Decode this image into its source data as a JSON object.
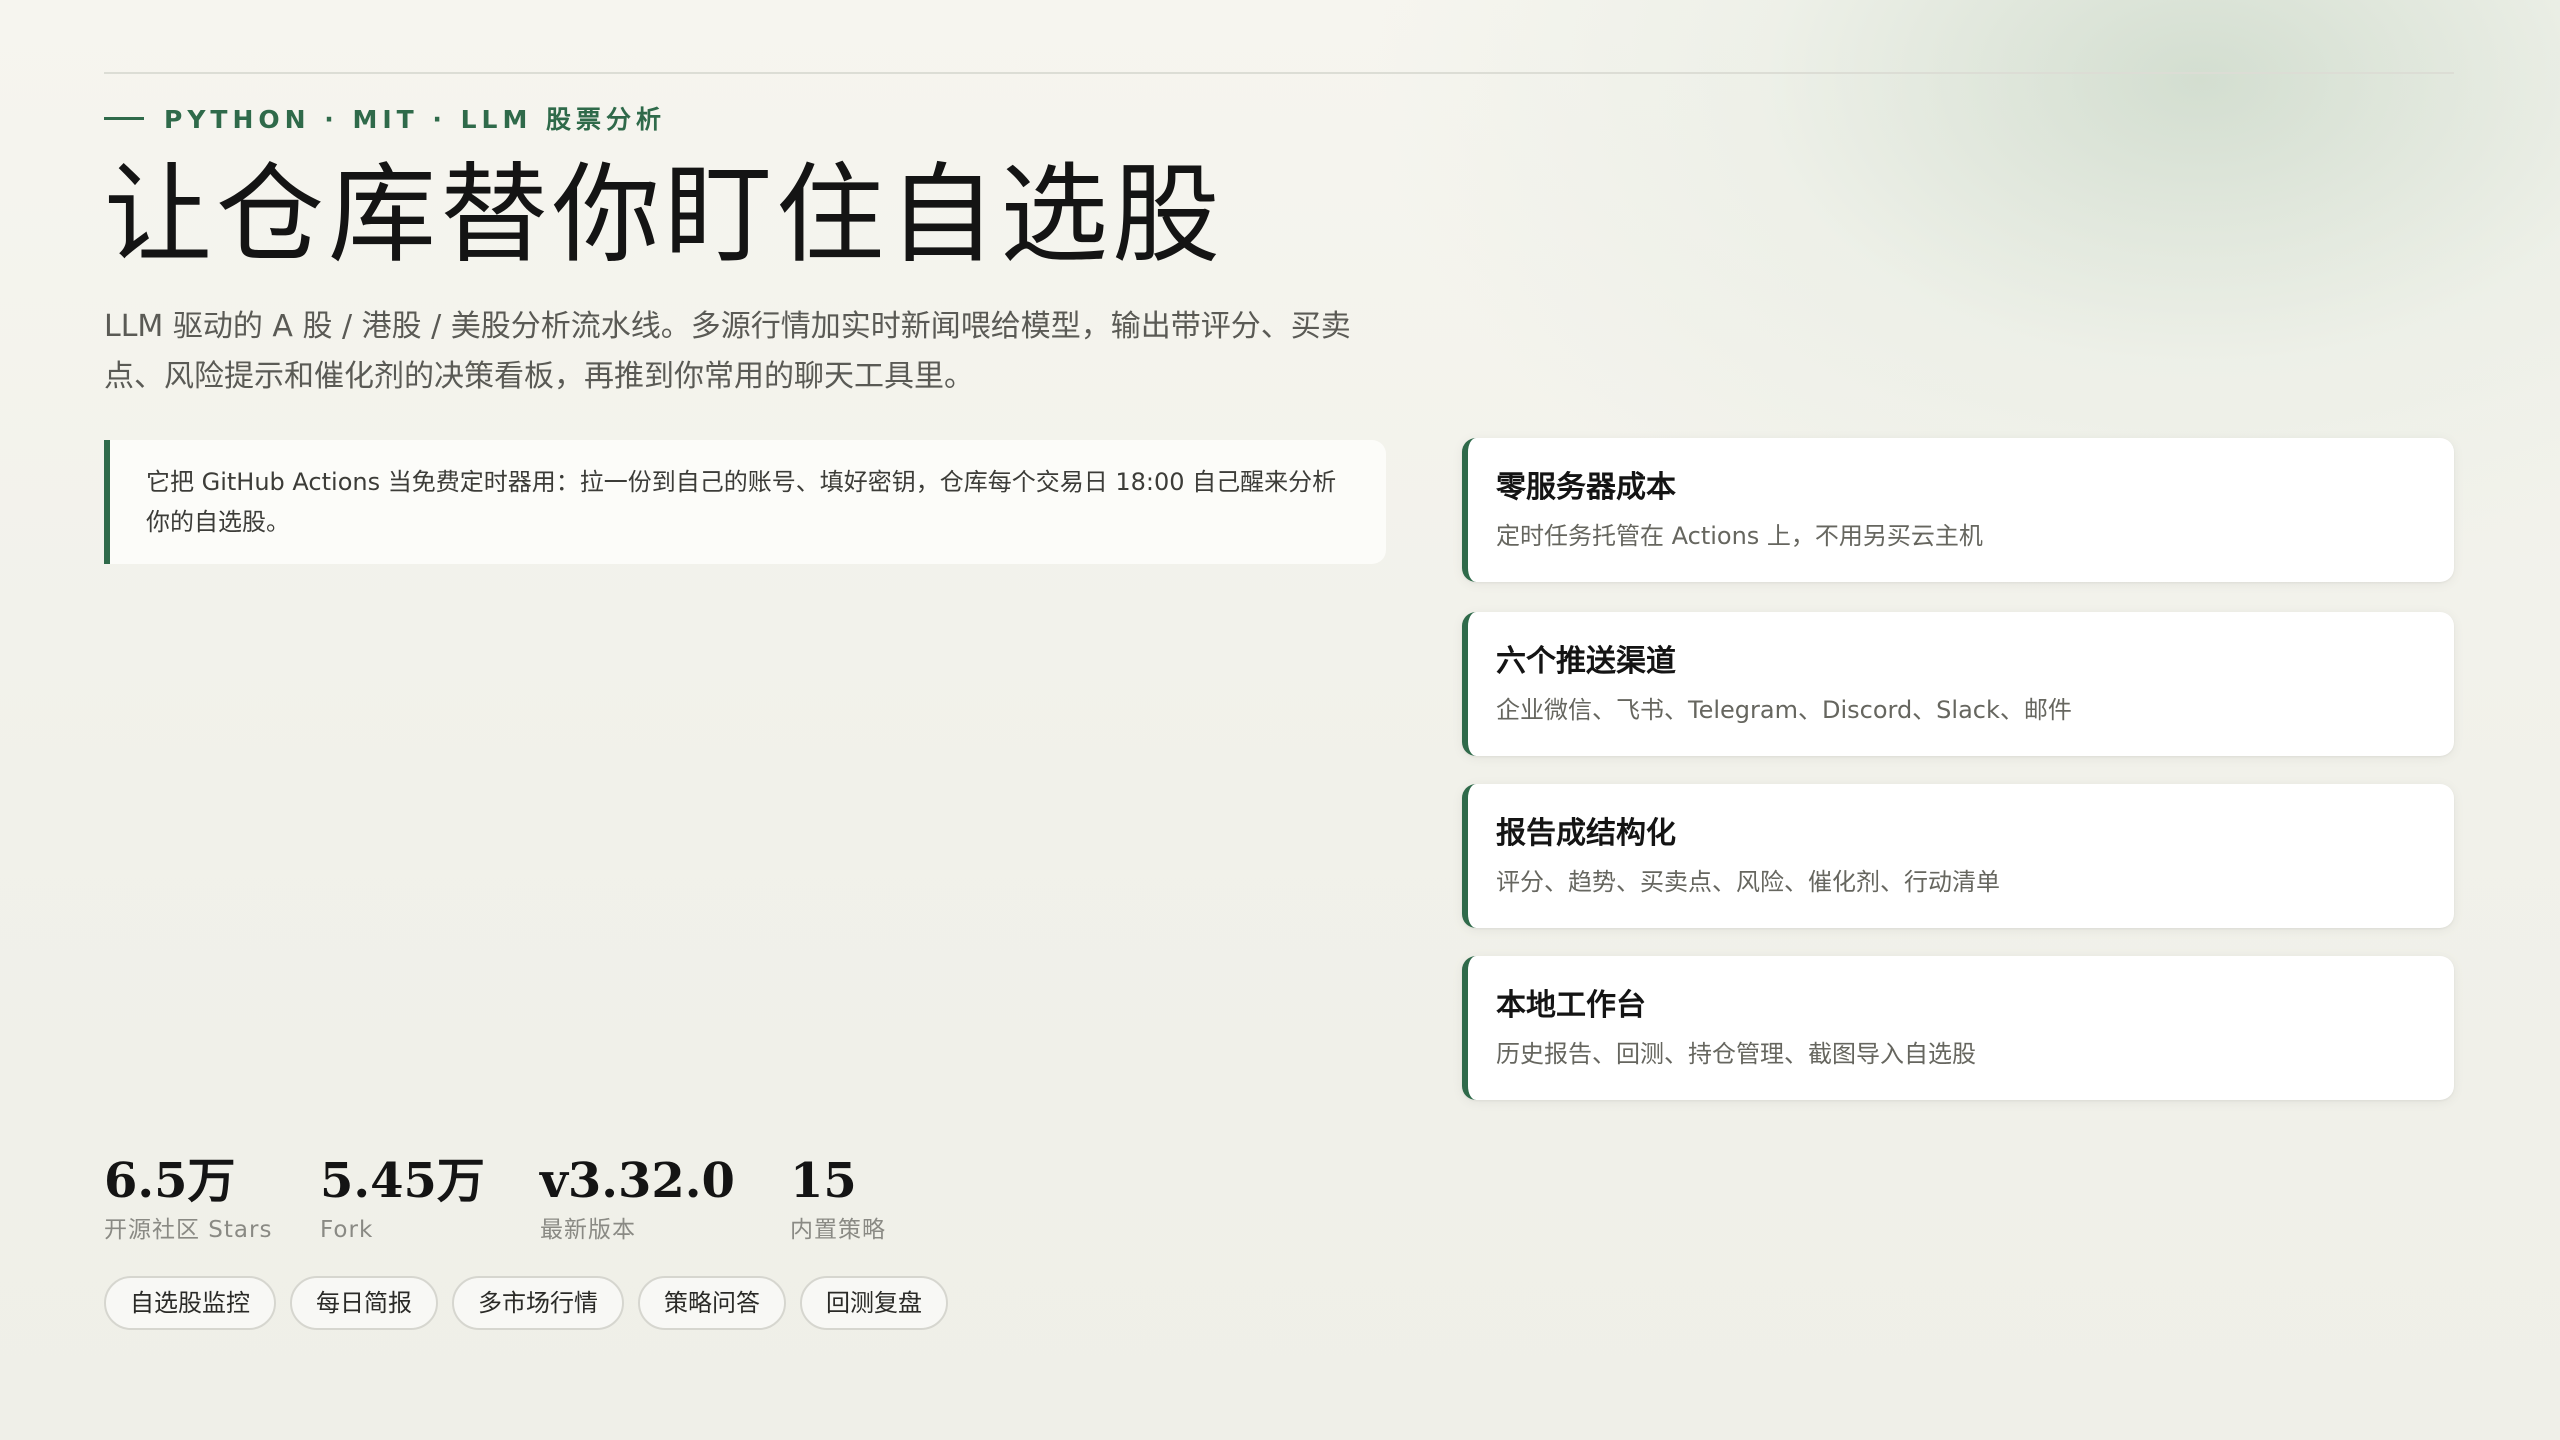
{
  "hero": {
    "eyebrow": "PYTHON · MIT · LLM 股票分析",
    "title": "让仓库替你盯住自选股",
    "description": "LLM 驱动的 A 股 / 港股 / 美股分析流水线。多源行情加实时新闻喂给模型，输出带评分、买卖点、风险提示和催化剂的决策看板，再推到你常用的聊天工具里。",
    "callout": "它把 GitHub Actions 当免费定时器用：拉一份到自己的账号、填好密钥，仓库每个交易日 18:00 自己醒来分析你的自选股。"
  },
  "features": [
    {
      "title": "零服务器成本",
      "desc": "定时任务托管在 Actions 上，不用另买云主机"
    },
    {
      "title": "六个推送渠道",
      "desc": "企业微信、飞书、Telegram、Discord、Slack、邮件"
    },
    {
      "title": "报告成结构化",
      "desc": "评分、趋势、买卖点、风险、催化剂、行动清单"
    },
    {
      "title": "本地工作台",
      "desc": "历史报告、回测、持仓管理、截图导入自选股"
    }
  ],
  "stats": [
    {
      "value": "6.5万",
      "label": "开源社区 Stars"
    },
    {
      "value": "5.45万",
      "label": "Fork"
    },
    {
      "value": "v3.32.0",
      "label": "最新版本"
    },
    {
      "value": "15",
      "label": "内置策略"
    }
  ],
  "tags": [
    "自选股监控",
    "每日简报",
    "多市场行情",
    "策略问答",
    "回测复盘"
  ],
  "colors": {
    "accent": "#2f6a4a",
    "background": "#f4f3ec",
    "card": "#ffffff"
  }
}
